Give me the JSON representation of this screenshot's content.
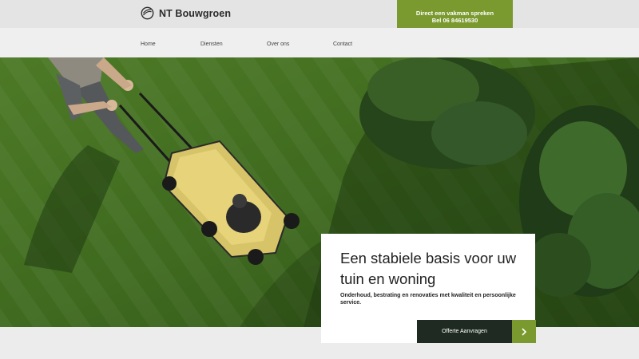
{
  "brand": {
    "name": "NT Bouwgroen",
    "logo_icon": "leaf-circle-icon",
    "accent": "#7a9a2f"
  },
  "cta": {
    "line1": "Direct een vakman spreken",
    "line2": "Bel 06 84619530"
  },
  "nav": {
    "items": [
      "Home",
      "Diensten",
      "Over ons",
      "Contact"
    ]
  },
  "hero": {
    "image": "aerial-lawn-mowing-photo",
    "title": "Een stabiele basis voor uw tuin en woning",
    "subtitle": "Onderhoud, bestrating en renovaties met kwaliteit en persoonlijke service.",
    "button_label": "Offerte Aanvragen",
    "button_icon": "chevron-right-icon",
    "button_color": "#1f2b22"
  }
}
